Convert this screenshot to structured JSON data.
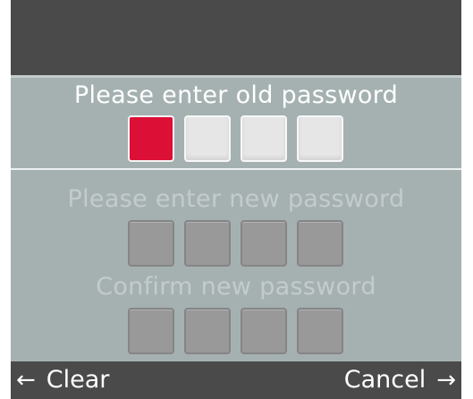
{
  "old_password": {
    "prompt": "Please enter old password",
    "digits_total": 4,
    "active_index": 0
  },
  "new_password": {
    "prompt": "Please enter new password",
    "digits_total": 4
  },
  "confirm_password": {
    "prompt": "Confirm new password",
    "digits_total": 4
  },
  "softkeys": {
    "left_label": "Clear",
    "left_icon": "arrow-left-icon",
    "right_label": "Cancel",
    "right_icon": "arrow-right-icon"
  },
  "colors": {
    "active_box": "#dc0f36",
    "panel": "#a5b1b1",
    "bar": "#4a4a4a"
  }
}
